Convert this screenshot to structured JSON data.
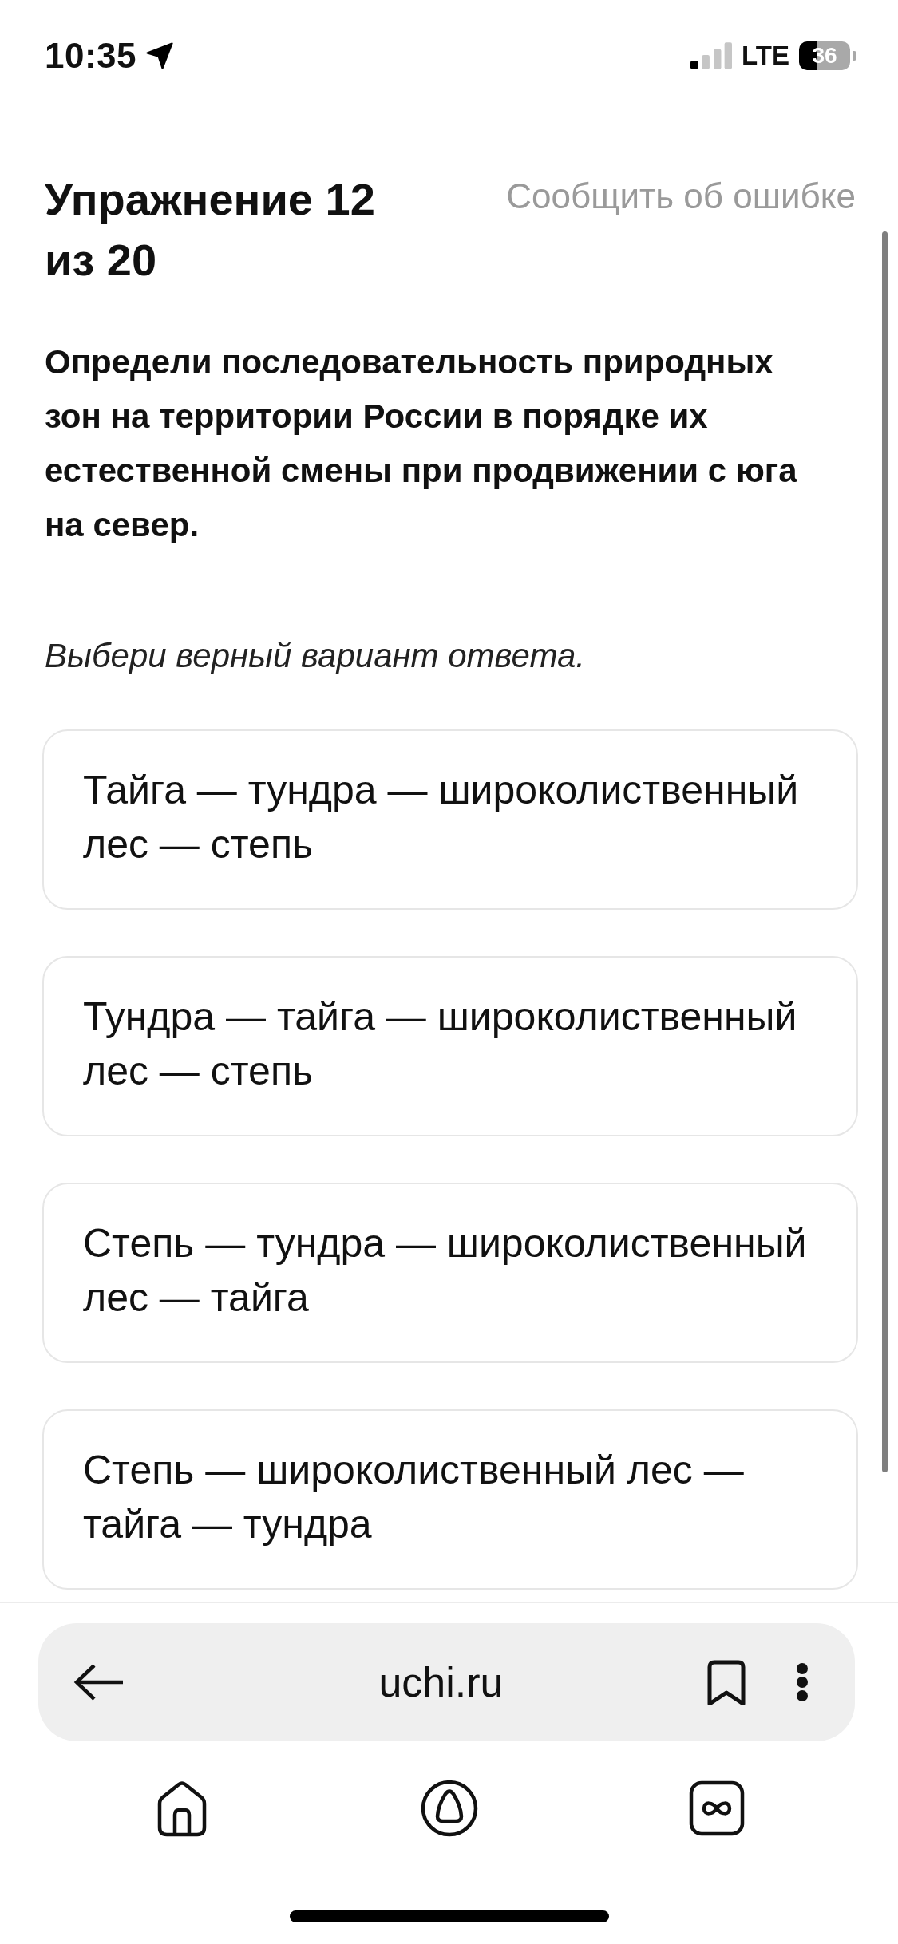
{
  "status_bar": {
    "time": "10:35",
    "network": "LTE",
    "battery": "36"
  },
  "header": {
    "title": "Упражнение 12 из 20",
    "report_link": "Сообщить об ошибке"
  },
  "question": "Определи последовательность природных зон на территории России в порядке их естественной смены при продвижении с юга на север.",
  "instruction": "Выбери верный вариант ответа.",
  "options": [
    {
      "text": "Тайга — тундра — широколиственный лес — степь",
      "selected": false
    },
    {
      "text": "Тундра — тайга — широколиственный лес — степь",
      "selected": false
    },
    {
      "text": "Степь — тундра — широколиственный лес — тайга",
      "selected": false
    },
    {
      "text": "Степь — широколиственный лес — тайга — тундра",
      "selected": false
    }
  ],
  "browser_bar": {
    "url": "uchi.ru"
  }
}
